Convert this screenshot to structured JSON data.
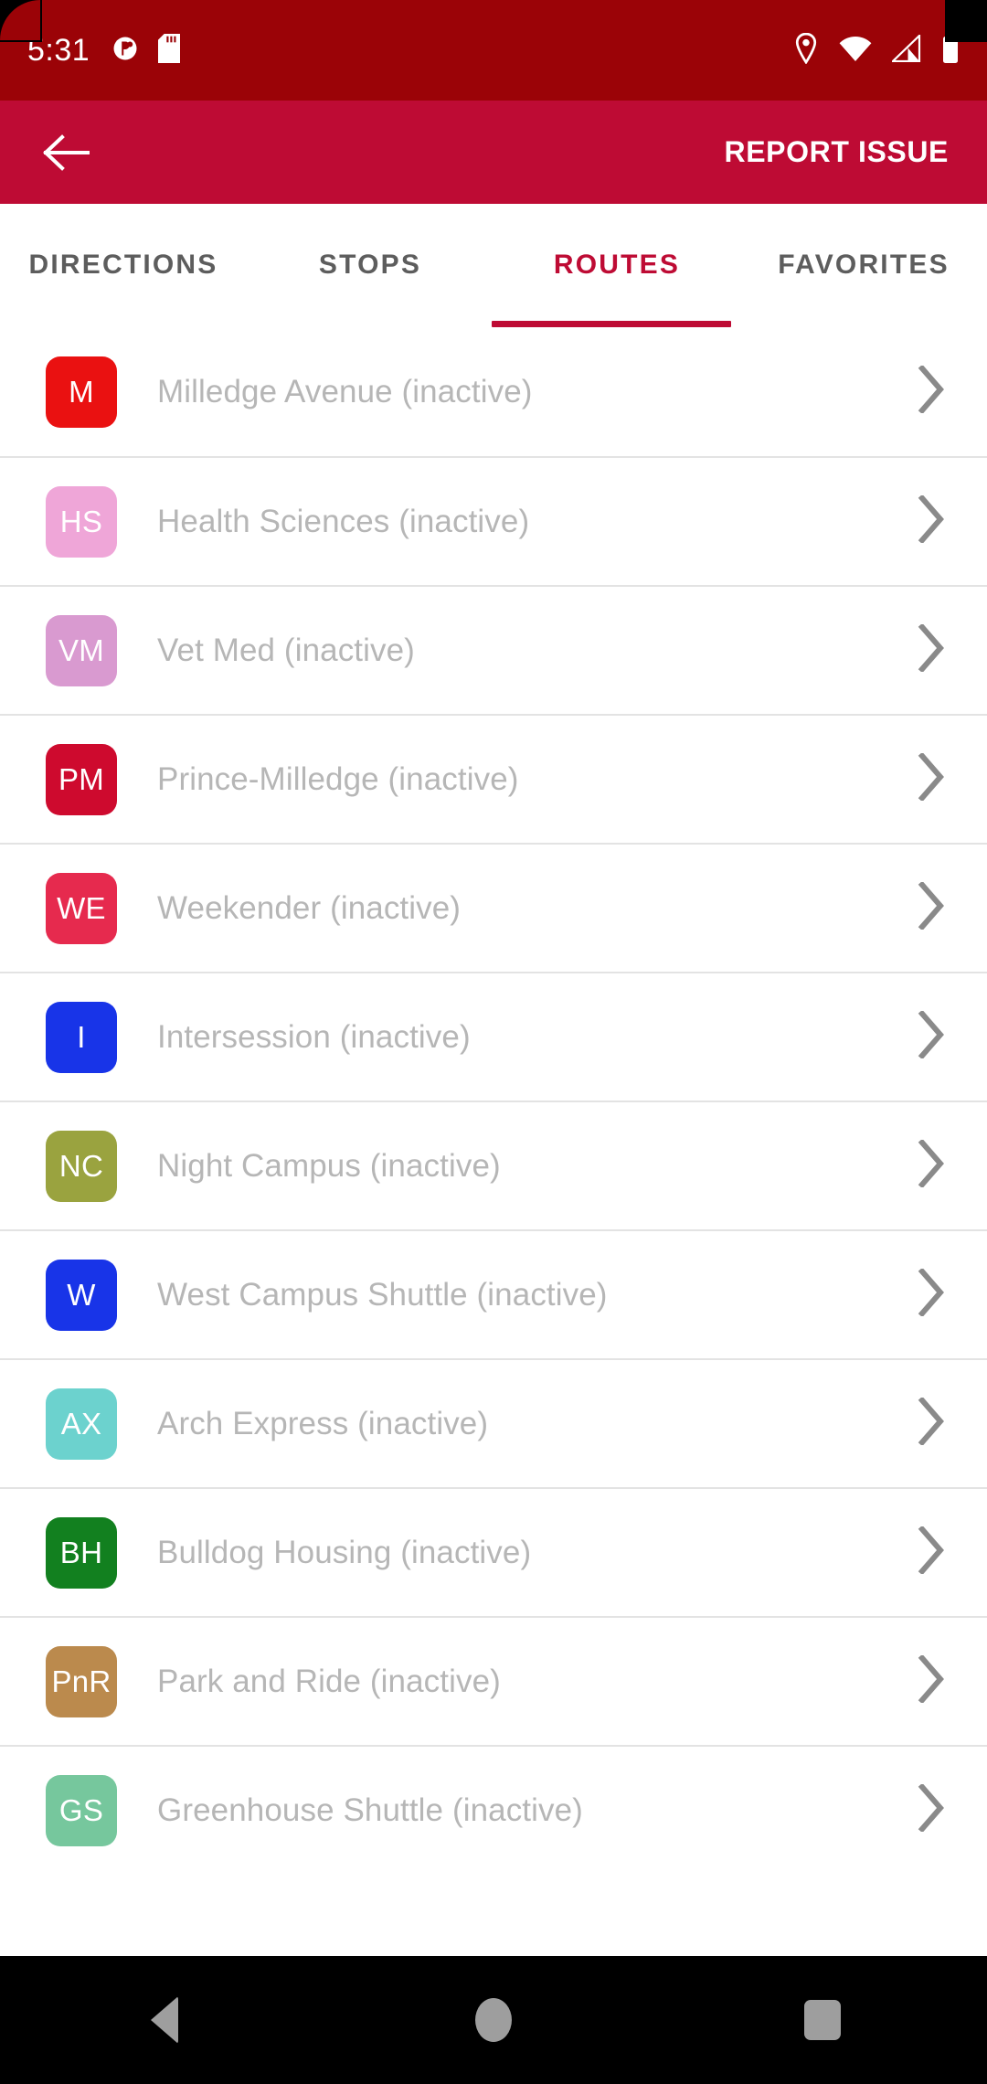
{
  "status_bar": {
    "time": "5:31",
    "left_icons": [
      "app-notification-icon",
      "sd-card-icon"
    ],
    "right_icons": [
      "location-pin-icon",
      "wifi-icon",
      "cell-signal-icon",
      "battery-icon"
    ],
    "background_color": "#9B0307"
  },
  "app_bar": {
    "back_label": "back-arrow",
    "action_label": "REPORT ISSUE",
    "background_color": "#BE0B34"
  },
  "tabs": {
    "accent_color": "#BE0B34",
    "inactive_color": "#5d5d5d",
    "items": [
      {
        "label": "DIRECTIONS",
        "active": false
      },
      {
        "label": "STOPS",
        "active": false
      },
      {
        "label": "ROUTES",
        "active": true
      },
      {
        "label": "FAVORITES",
        "active": false
      }
    ]
  },
  "routes": {
    "inactive_suffix": "(inactive)",
    "name_color": "#b6b6b6",
    "items": [
      {
        "code": "M",
        "name": "Milledge Avenue (inactive)",
        "color": "#EA1111"
      },
      {
        "code": "HS",
        "name": "Health Sciences (inactive)",
        "color": "#EFA6D8"
      },
      {
        "code": "VM",
        "name": "Vet Med (inactive)",
        "color": "#D99AD0"
      },
      {
        "code": "PM",
        "name": "Prince-Milledge (inactive)",
        "color": "#CE0A2E"
      },
      {
        "code": "WE",
        "name": "Weekender (inactive)",
        "color": "#E62A4E"
      },
      {
        "code": "I",
        "name": "Intersession (inactive)",
        "color": "#1834E8"
      },
      {
        "code": "NC",
        "name": "Night Campus (inactive)",
        "color": "#9AA33F"
      },
      {
        "code": "W",
        "name": "West Campus Shuttle (inactive)",
        "color": "#1834E8"
      },
      {
        "code": "AX",
        "name": "Arch Express (inactive)",
        "color": "#6CD2CE"
      },
      {
        "code": "BH",
        "name": "Bulldog Housing (inactive)",
        "color": "#12801F"
      },
      {
        "code": "PnR",
        "name": "Park and Ride (inactive)",
        "color": "#BB8A4D"
      },
      {
        "code": "GS",
        "name": "Greenhouse Shuttle (inactive)",
        "color": "#76C79D"
      }
    ]
  },
  "nav_bar": {
    "buttons": [
      {
        "name": "back",
        "icon": "triangle-back-icon"
      },
      {
        "name": "home",
        "icon": "circle-home-icon"
      },
      {
        "name": "recents",
        "icon": "square-recents-icon"
      }
    ]
  }
}
